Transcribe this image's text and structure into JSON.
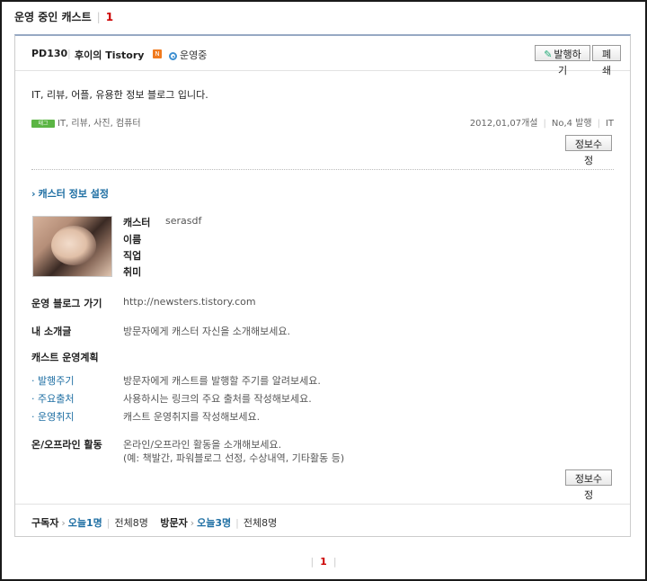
{
  "header": {
    "title": "운영 중인 캐스트",
    "count": "1"
  },
  "cast": {
    "code": "PD130",
    "blog_name": "후이의 Tistory",
    "badge": "N",
    "status": "운영중",
    "publish_label": "발행하기",
    "close_label": "폐쇄",
    "description": "IT, 리뷰, 어플, 유용한 정보 블로그 입니다.",
    "tag_label": "태그",
    "tags": "IT, 리뷰, 사진, 컴퓨터",
    "opened": "2012,01,07개설",
    "issues": "No,4 발행",
    "category": "IT",
    "edit_label": "정보수정"
  },
  "caster": {
    "section_title": "캐스터 정보 설정",
    "rows": [
      {
        "label": "캐스터",
        "value": "serasdf"
      },
      {
        "label": "이름",
        "value": ""
      },
      {
        "label": "직업",
        "value": ""
      },
      {
        "label": "취미",
        "value": ""
      }
    ],
    "blog_label": "운영 블로그 가기",
    "blog_url": "http://newsters.tistory.com",
    "intro_label": "내 소개글",
    "intro_value": "방문자에게 캐스터 자신을 소개해보세요.",
    "plan_label": "캐스트 운영계획",
    "plan": [
      {
        "label": "· 발행주기",
        "value": "방문자에게 캐스트를 발행할 주기를 알려보세요."
      },
      {
        "label": "· 주요출처",
        "value": "사용하시는 링크의 주요 출처를 작성해보세요."
      },
      {
        "label": "· 운영취지",
        "value": "캐스트 운영취지를 작성해보세요."
      }
    ],
    "activity_label": "온/오프라인 활동",
    "activity_line1": "온라인/오프라인 활동을 소개해보세요.",
    "activity_line2": "(예: 책발간, 파워블로그 선정, 수상내역, 기타활동 등)",
    "edit_label": "정보수정"
  },
  "stats": {
    "subscriber_label": "구독자",
    "subscriber_today": "오늘1명",
    "subscriber_total": "전체8명",
    "visitor_label": "방문자",
    "visitor_today": "오늘3명",
    "visitor_total": "전체8명"
  },
  "pager": {
    "current": "1"
  },
  "colors": {
    "accent_blue": "#1f6fa3",
    "count_red": "#cc0000",
    "tag_green": "#5bb544",
    "badge_orange": "#f07a1e"
  }
}
